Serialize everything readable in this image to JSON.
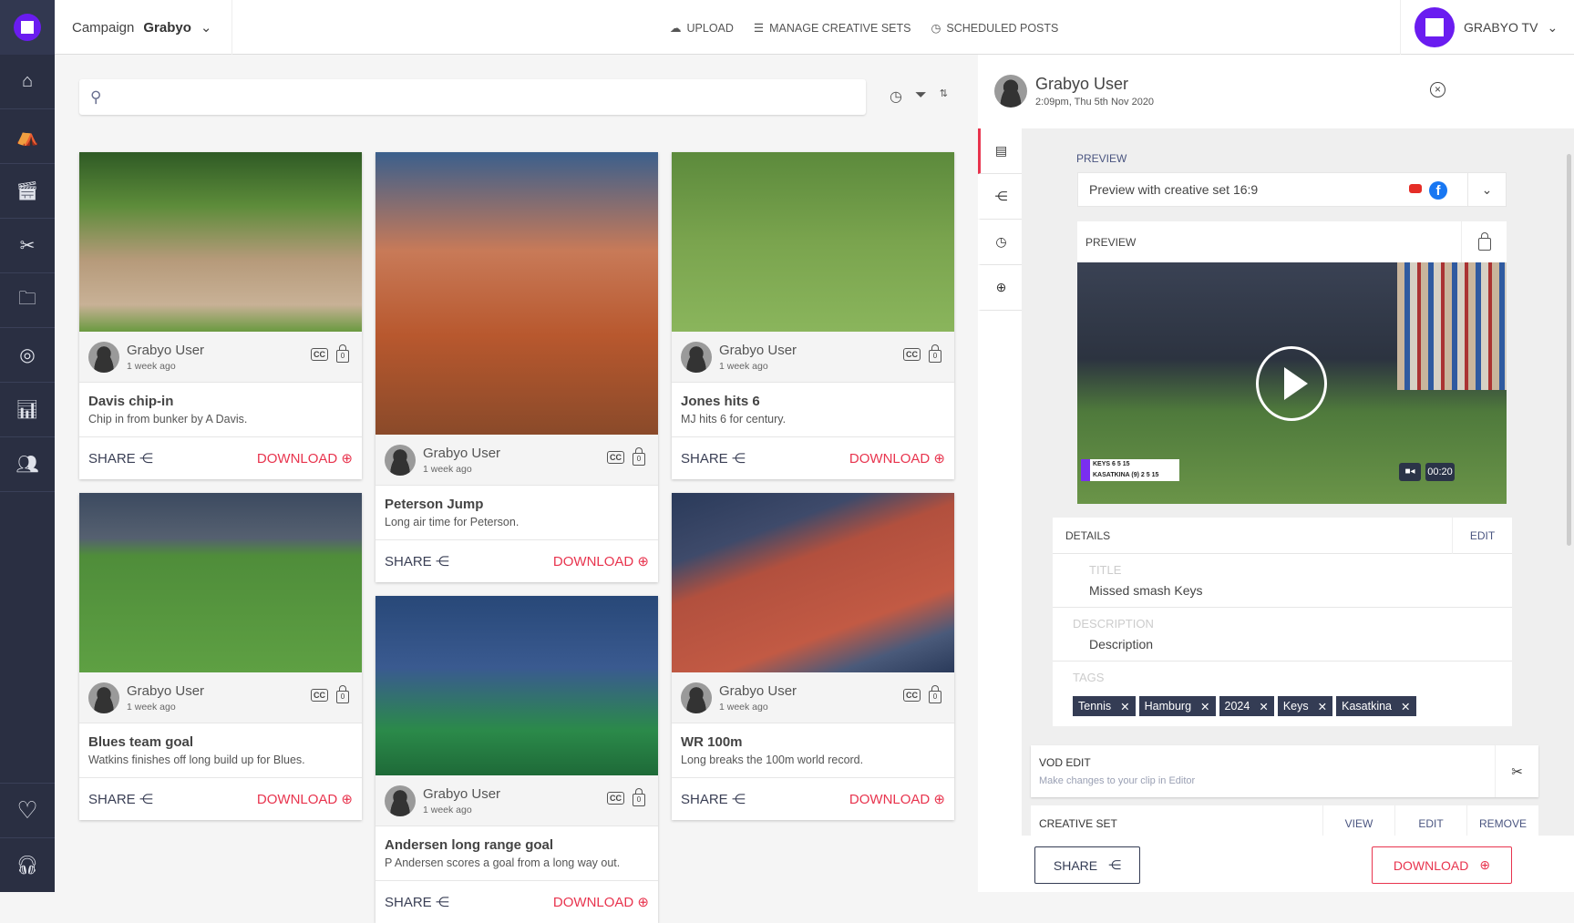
{
  "topbar": {
    "campaign_label": "Campaign",
    "campaign_value": "Grabyo",
    "nav": [
      {
        "label": "UPLOAD",
        "icon": "upload-cloud-icon"
      },
      {
        "label": "MANAGE CREATIVE SETS",
        "icon": "list-icon"
      },
      {
        "label": "SCHEDULED POSTS",
        "icon": "clock-icon"
      }
    ],
    "brand": "GRABYO TV"
  },
  "sidebar": {
    "items": [
      "home-icon",
      "director-chair-icon",
      "clapperboard-icon",
      "video-edit-icon",
      "folder-icon",
      "live-stream-icon",
      "analytics-icon",
      "users-icon"
    ],
    "bottom": [
      "heart-icon",
      "headset-icon"
    ]
  },
  "search": {
    "placeholder": ""
  },
  "cards": [
    {
      "title": "Davis chip-in",
      "desc": "Chip in from bunker by A Davis.",
      "user": "Grabyo User",
      "ago": "1 week ago",
      "bg": "golf"
    },
    {
      "title": "Blues team goal",
      "desc": "Watkins finishes off long build up for Blues.",
      "user": "Grabyo User",
      "ago": "1 week ago",
      "bg": "soccer"
    },
    {
      "title": "Peterson Jump",
      "desc": "Long air time for Peterson.",
      "user": "Grabyo User",
      "ago": "1 week ago",
      "bg": "moto"
    },
    {
      "title": "Andersen long range goal",
      "desc": "P Andersen scores a goal from a long way out.",
      "user": "Grabyo User",
      "ago": "1 week ago",
      "bg": "lacrosse"
    },
    {
      "title": "Jones hits 6",
      "desc": "MJ hits 6 for century.",
      "user": "Grabyo User",
      "ago": "1 week ago",
      "bg": "cricket"
    },
    {
      "title": "WR 100m",
      "desc": "Long breaks the 100m world record.",
      "user": "Grabyo User",
      "ago": "1 week ago",
      "bg": "track"
    }
  ],
  "card_labels": {
    "share": "SHARE",
    "download": "DOWNLOAD",
    "cc": "CC",
    "lock_count": "0"
  },
  "panel": {
    "user": "Grabyo User",
    "date": "2:09pm, Thu 5th Nov 2020",
    "preview_label": "PREVIEW",
    "preview_select": "Preview with creative set 16:9",
    "preview_card_label": "PREVIEW",
    "video": {
      "duration": "00:20",
      "score": [
        {
          "name": "KEYS",
          "s1": "6",
          "s2": "5",
          "pts": "15"
        },
        {
          "name": "KASATKINA (9)",
          "s1": "2",
          "s2": "5",
          "pts": "15"
        }
      ]
    },
    "details": {
      "header": "DETAILS",
      "edit": "EDIT",
      "title_label": "TITLE",
      "title_value": "Missed smash Keys",
      "desc_label": "DESCRIPTION",
      "desc_value": "Description",
      "tags_label": "TAGS",
      "tags": [
        "Tennis",
        "Hamburg",
        "2024",
        "Keys",
        "Kasatkina"
      ]
    },
    "vod": {
      "title": "VOD EDIT",
      "subtitle": "Make changes to your clip in Editor"
    },
    "creative_set": {
      "label": "CREATIVE SET",
      "view": "VIEW",
      "edit": "EDIT",
      "remove": "REMOVE"
    },
    "share": "SHARE",
    "download": "DOWNLOAD"
  },
  "colors": {
    "accent": "#e8344e",
    "brand": "#6a1cf0",
    "sidebar": "#2a2f42",
    "tag": "#343c54"
  }
}
